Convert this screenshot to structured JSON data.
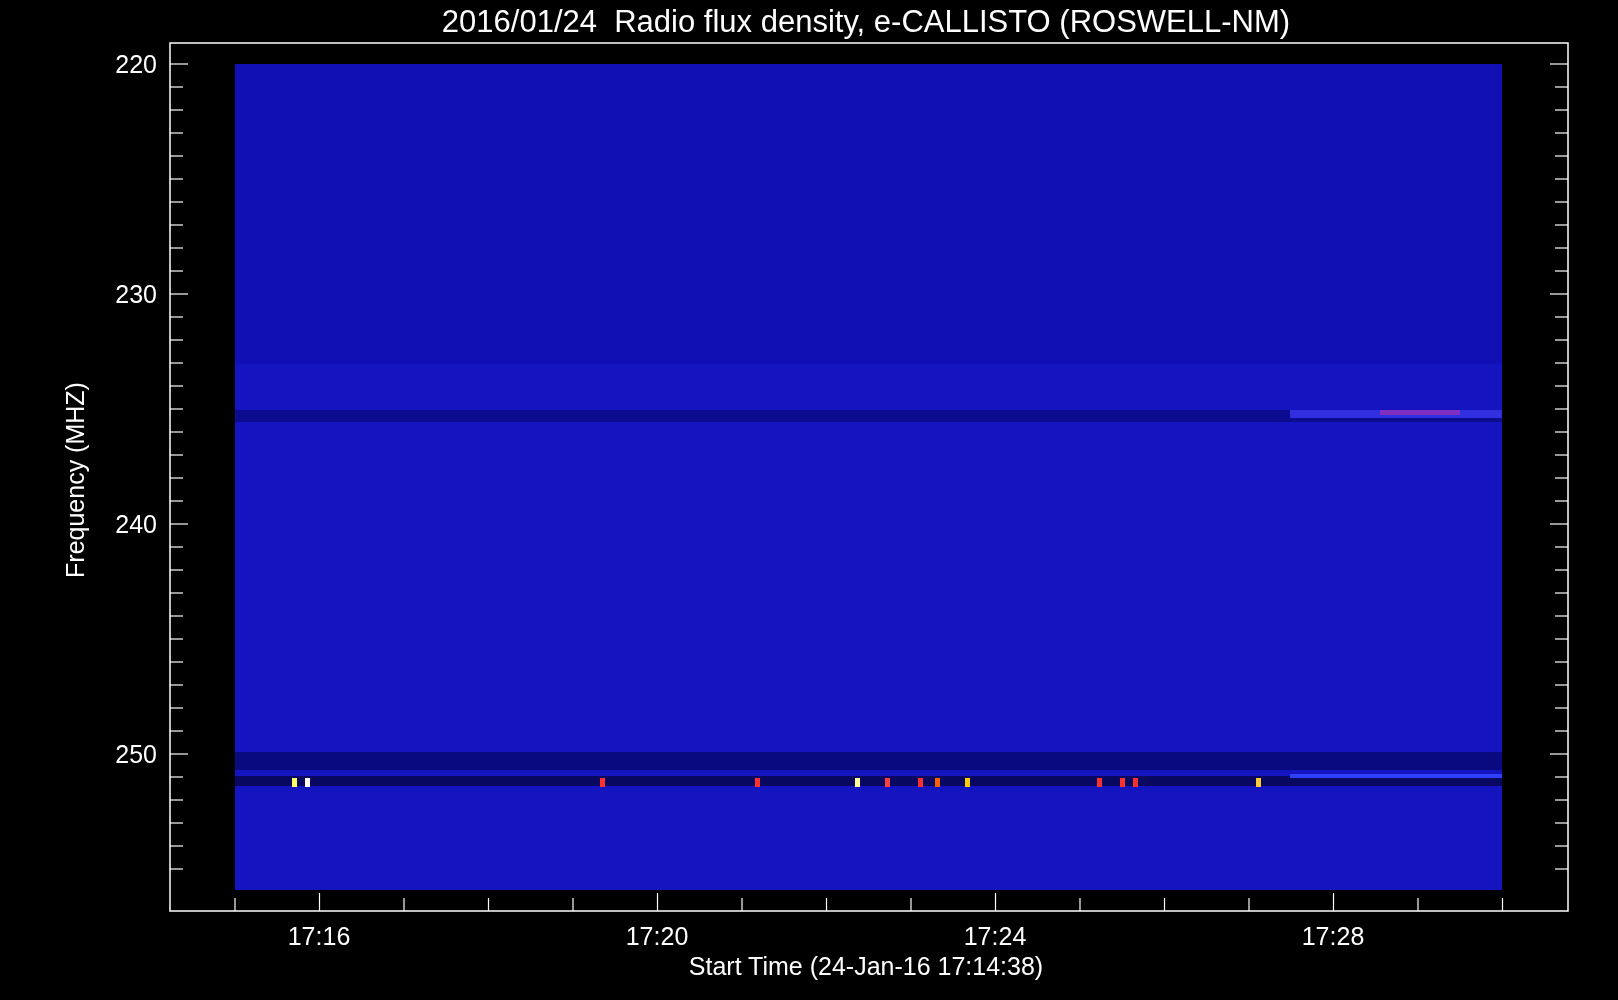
{
  "plot": {
    "title": "2016/01/24  Radio flux density, e-CALLISTO (ROSWELL-NM)",
    "ylabel": "Frequency (MHZ)",
    "xlabel": "Start Time (24-Jan-16 17:14:38)",
    "yticks": [
      "220",
      "230",
      "240",
      "250"
    ],
    "xticks": [
      "17:16",
      "17:20",
      "17:24",
      "17:28"
    ]
  }
}
